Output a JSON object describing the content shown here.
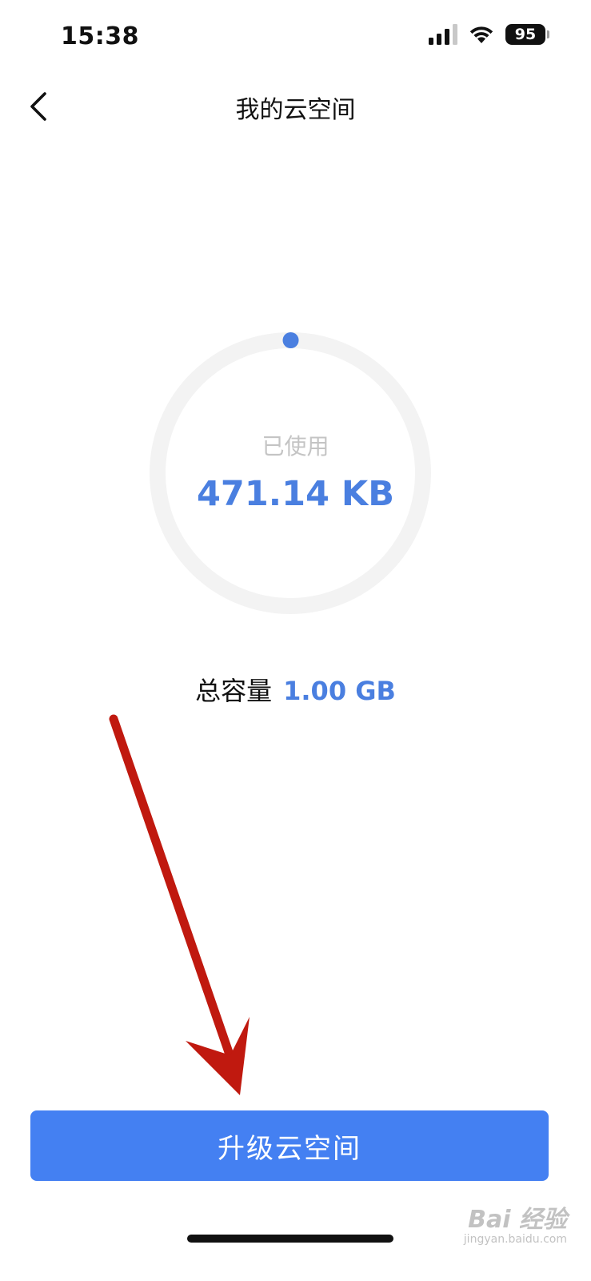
{
  "status_bar": {
    "time": "15:38",
    "battery": "95"
  },
  "nav": {
    "back_icon": "chevron-left-icon",
    "title": "我的云空间"
  },
  "usage": {
    "label": "已使用",
    "value": "471.14 KB",
    "used_fraction": 0.0005,
    "accent_color": "#4a7fe0",
    "track_color": "#f3f3f3"
  },
  "capacity": {
    "label": "总容量",
    "value": "1.00 GB"
  },
  "button": {
    "label": "升级云空间",
    "color": "#4480f2"
  },
  "annotation": {
    "arrow_color": "#c0190f"
  },
  "watermark": {
    "main": "Bai 经验",
    "sub": "jingyan.baidu.com"
  }
}
